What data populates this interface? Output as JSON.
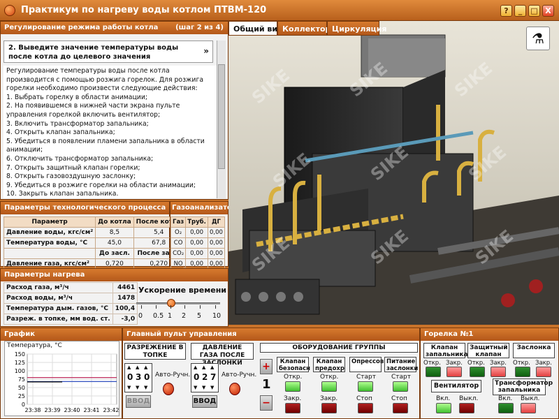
{
  "window": {
    "title": "Практикум по нагреву воды котлом ПТВМ-120",
    "help": "?",
    "minimize": "_",
    "restore": "□",
    "close": "X"
  },
  "left": {
    "section_title": "Регулирование режима работы котла",
    "step_counter": "(шаг 2 из 4)",
    "step_title": "2.  Выведите значение температуры воды после котла до целевого значения",
    "collapse_icon": "»",
    "instructions": [
      "Регулирование температуры воды после котла",
      "производится с помощью розжига горелок. Для розжига",
      "горелки необходимо произвести следующие действия:",
      "1. Выбрать горелку в области анимации;",
      "2. На появившемся в нижней части экрана пульте",
      "управления горелкой включить вентилятор;",
      "3. Включить трансформатор запальника;",
      "4. Открыть клапан запальника;",
      "5. Убедиться в появлении пламени запальника в области",
      "анимации;",
      "6. Отключить трансформатор запальника;",
      "7. Открыть защитный клапан горелки;",
      "8. Открыть газовоздушную заслонку;",
      "9. Убедиться в розжиге горелки на области анимации;",
      "10. Закрыть клапан запальника."
    ]
  },
  "process": {
    "title": "Параметры технологического процесса",
    "headers": [
      "Параметр",
      "До котла",
      "После котла"
    ],
    "rows": [
      [
        "Давление воды, кгс/см²",
        "8,5",
        "5,4"
      ],
      [
        "Температура воды, °С",
        "45,0",
        "67,8"
      ]
    ],
    "sub_headers": [
      "До засл.",
      "После засл."
    ],
    "gas_row": [
      "Давление газа, кгс/см²",
      "0,720",
      "0,270"
    ]
  },
  "gas_analyzer": {
    "title": "Газоанализатор",
    "headers": [
      "Газ",
      "Труб.",
      "ДГ"
    ],
    "rows": [
      [
        "O₂",
        "0,00",
        "0,00"
      ],
      [
        "CO",
        "0,00",
        "0,00"
      ],
      [
        "CO₂",
        "0,00",
        "0,00"
      ],
      [
        "NO",
        "0,00",
        "0,00"
      ]
    ]
  },
  "heating": {
    "title": "Параметры нагрева",
    "rows": [
      [
        "Расход газа, м³/ч",
        "4461"
      ],
      [
        "Расход воды, м³/ч",
        "1478"
      ],
      [
        "Температура дым. газов, °С",
        "100,4"
      ],
      [
        "Разреж. в топке, мм вод. ст.",
        "-3,0"
      ]
    ]
  },
  "time_accel": {
    "title": "Ускорение времени",
    "ticks": [
      "0",
      "0.5",
      "1",
      "2",
      "5",
      "10"
    ],
    "value": 1
  },
  "nav": {
    "prev_icon": "arrow-left",
    "next_icon": "arrow-right"
  },
  "tabs": [
    {
      "label": "Общий вид",
      "active": true
    },
    {
      "label": "Коллектор",
      "active": false
    },
    {
      "label": "Циркуляция",
      "active": false
    }
  ],
  "graph": {
    "title": "График",
    "ylabel": "Температура, °С",
    "yticks": [
      "150",
      "125",
      "100",
      "75",
      "50",
      "25",
      "0"
    ],
    "xticks": [
      "23:38",
      "23:39",
      "23:40",
      "23:41",
      "23:42"
    ]
  },
  "chart_data": {
    "type": "line",
    "ylabel": "Температура, °С",
    "ylim": [
      0,
      150
    ],
    "categories": [
      "23:38",
      "23:39",
      "23:40",
      "23:41",
      "23:42"
    ],
    "series": [
      {
        "values": [
          80,
          80,
          80,
          80,
          80
        ],
        "color": "#c03060"
      },
      {
        "values": [
          68,
          68,
          68,
          68,
          68
        ],
        "color": "#3050c0"
      },
      {
        "values": [
          67,
          67,
          null,
          null,
          null
        ],
        "color": "#000000"
      }
    ]
  },
  "main_panel": {
    "title": "Главный пульт управления",
    "vacuum": {
      "label": "РАЗРЕЖЕНИЕ В ТОПКЕ",
      "digits": [
        "0",
        "3",
        "0"
      ],
      "mode": "Авто-Ручн.",
      "enter": "ВВОД"
    },
    "gas_pressure": {
      "label": "ДАВЛЕНИЕ ГАЗА ПОСЛЕ ЗАСЛОНКИ",
      "digits": [
        "0",
        "2",
        "7"
      ],
      "mode": "Авто-Ручн.",
      "enter": "ВВОД"
    },
    "group": {
      "title": "ОБОРУДОВАНИЕ ГРУППЫ",
      "number": "1",
      "plus": "+",
      "minus": "−",
      "columns": [
        {
          "label": "Клапан безопасн",
          "top": "Откр.",
          "bottom": "Закр."
        },
        {
          "label": "Клапан предохр",
          "top": "Откр.",
          "bottom": "Закр."
        },
        {
          "label": "Опрессов",
          "top": "Старт",
          "bottom": "Стоп"
        },
        {
          "label": "Питание заслонки",
          "top": "Старт",
          "bottom": "Стоп"
        }
      ]
    }
  },
  "burner": {
    "title": "Горелка №1",
    "buttons": [
      {
        "label": "Клапан запальника",
        "on": "Откр.",
        "off": "Закр."
      },
      {
        "label": "Защитный клапан",
        "on": "Откр.",
        "off": "Закр."
      },
      {
        "label": "Заслонка",
        "on": "Откр.",
        "off": "Закр."
      }
    ],
    "fan": {
      "label": "Вентилятор",
      "on": "Вкл.",
      "off": "Выкл."
    },
    "transformer": {
      "label": "Трансформатор запальника",
      "on": "Вкл.",
      "off": "Выкл."
    }
  },
  "watermark": "SIKE",
  "colors": {
    "accent": "#c8732a",
    "header": "#b3581a",
    "led_green": "#3fbf2f",
    "led_red": "#e24040"
  }
}
